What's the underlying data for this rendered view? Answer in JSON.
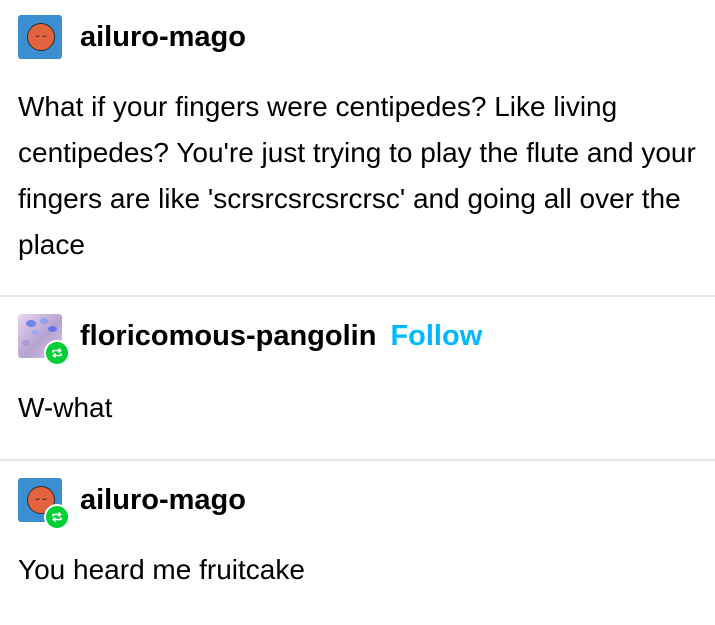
{
  "posts": [
    {
      "username": "ailuro-mago",
      "text": "What if your fingers were centipedes? Like living centipedes? You're just trying to play the flute and your fingers are like 'scrsrcsrcsrcrsc' and going all over the place",
      "reblogged": false
    },
    {
      "username": "floricomous-pangolin",
      "follow_label": "Follow",
      "text": "W-what",
      "reblogged": true
    },
    {
      "username": "ailuro-mago",
      "text": "You heard me fruitcake",
      "reblogged": true
    }
  ],
  "colors": {
    "follow": "#00b8ff",
    "reblog_badge": "#00cf35",
    "avatar_ailuro_bg": "#3b8fd1",
    "avatar_ailuro_face": "#e2643f",
    "divider": "#e6e6e6"
  },
  "icons": {
    "reblog": "reblog-icon"
  }
}
